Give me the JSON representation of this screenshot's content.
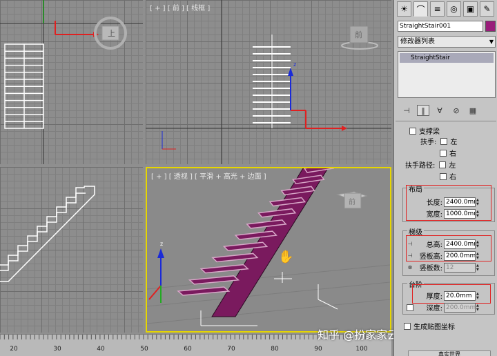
{
  "viewports": {
    "front_label": "[ + ] [ 前 ] [ 线框 ]",
    "perspective_label": "[ + ] [ 透视 ] [ 平滑 + 高光 + 边面 ]",
    "viewcube_top": "上",
    "viewcube_front": "前",
    "viewcube_persp": "前",
    "axis_z": "z",
    "axis_x": "x",
    "axis_y": "y"
  },
  "timeline": {
    "ticks": [
      "20",
      "30",
      "40",
      "50",
      "60",
      "70",
      "80",
      "90",
      "100"
    ]
  },
  "watermark": "知乎 @扮家家云渲染农场",
  "panel": {
    "tabs": [
      {
        "name": "create-tab-icon",
        "glyph": "☀"
      },
      {
        "name": "modify-tab-icon",
        "glyph": "⌒"
      },
      {
        "name": "hierarchy-tab-icon",
        "glyph": "≡"
      },
      {
        "name": "motion-tab-icon",
        "glyph": "◎"
      },
      {
        "name": "display-tab-icon",
        "glyph": "▣"
      },
      {
        "name": "utilities-tab-icon",
        "glyph": "✎"
      }
    ],
    "object_name": "StraightStair001",
    "object_color": "#9a1c7a",
    "modifier_list": "修改器列表",
    "stack_item": "StraightStair",
    "handrail": {
      "partial_title": "支撑梁",
      "handrail_label": "扶手:",
      "handrail_path_label": "扶手路径:",
      "left": "左",
      "right": "右"
    },
    "layout": {
      "title": "布局",
      "length_label": "长度:",
      "length_value": "2400.0mm",
      "width_label": "宽度:",
      "width_value": "1000.0mm"
    },
    "steps": {
      "title": "梯级",
      "overall_label": "总高:",
      "overall_value": "2400.0mm",
      "riser_height_label": "竖板高:",
      "riser_height_value": "200.0mm",
      "riser_count_label": "竖板数:",
      "riser_count_value": "12"
    },
    "treads": {
      "title": "台阶",
      "thickness_label": "厚度:",
      "thickness_value": "20.0mm",
      "depth_label": "深度:",
      "depth_value": "200.0mm"
    },
    "gen_mapping": "生成贴图坐标",
    "bottom_button": "真实世界"
  },
  "colors": {
    "stair": "#7a1a5e",
    "tread": "#d7a6c7",
    "accent_yellow": "#e6d600",
    "axis_red": "#e02020",
    "axis_blue": "#1a2ad8",
    "axis_green": "#22aa22"
  }
}
